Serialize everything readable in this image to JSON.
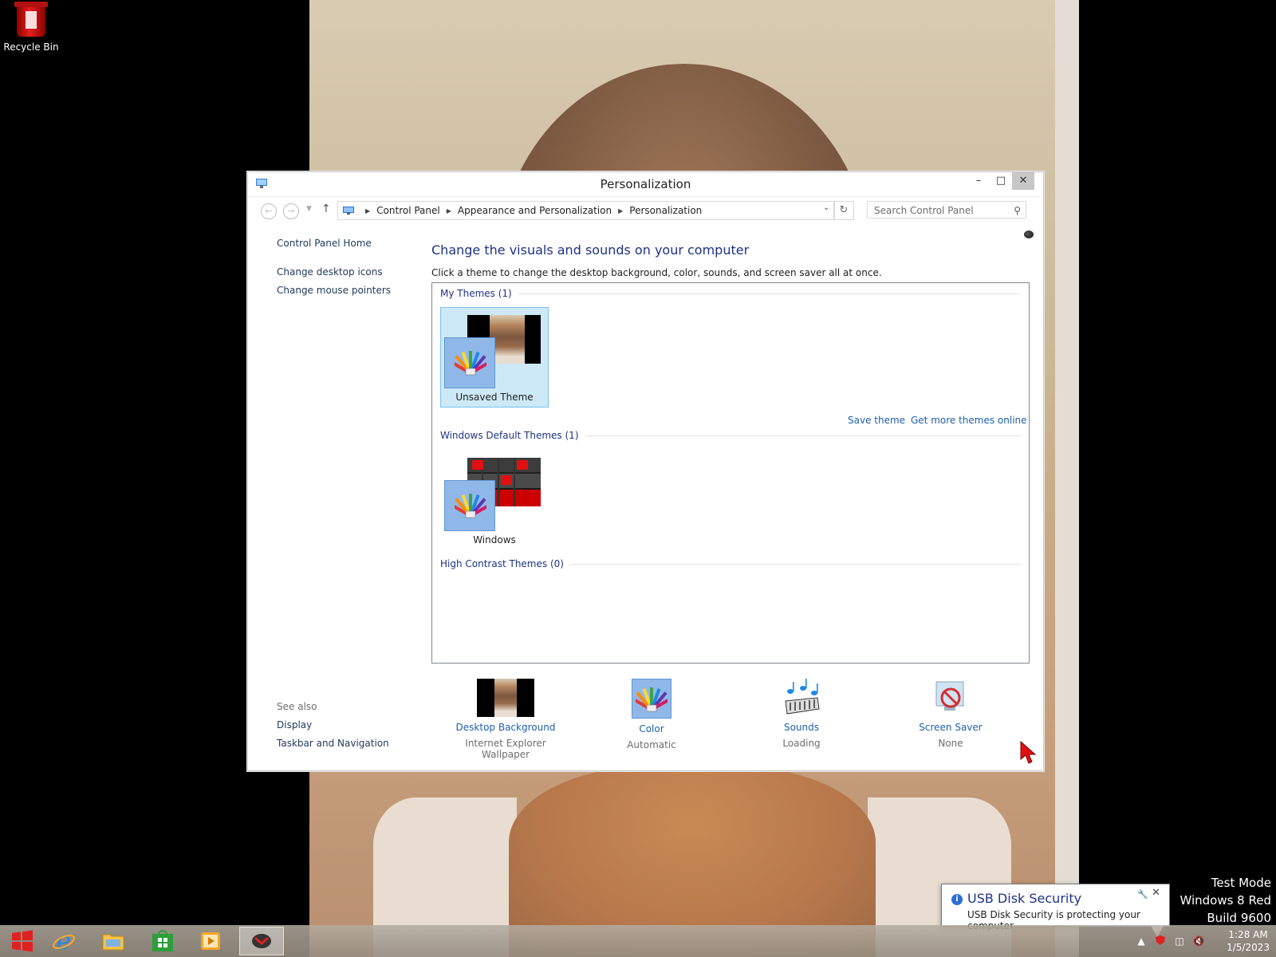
{
  "desktop": {
    "recycle_bin_label": "Recycle Bin"
  },
  "window": {
    "title": "Personalization",
    "breadcrumbs": [
      "Control Panel",
      "Appearance and Personalization",
      "Personalization"
    ],
    "search_placeholder": "Search Control Panel",
    "left_links": {
      "home": "Control Panel Home",
      "desktop_icons": "Change desktop icons",
      "mouse_pointers": "Change mouse pointers"
    },
    "see_also": {
      "heading": "See also",
      "display": "Display",
      "taskbar": "Taskbar and Navigation"
    },
    "heading": "Change the visuals and sounds on your computer",
    "description": "Click a theme to change the desktop background, color, sounds, and screen saver all at once.",
    "groups": {
      "my_themes": "My Themes (1)",
      "default_themes": "Windows Default Themes (1)",
      "high_contrast": "High Contrast Themes (0)"
    },
    "themes": {
      "unsaved": "Unsaved Theme",
      "windows": "Windows"
    },
    "links": {
      "save_theme": "Save theme",
      "more_themes": "Get more themes online"
    },
    "settings": [
      {
        "name": "Desktop Background",
        "value": "Internet Explorer Wallpaper"
      },
      {
        "name": "Color",
        "value": "Automatic"
      },
      {
        "name": "Sounds",
        "value": "Loading"
      },
      {
        "name": "Screen Saver",
        "value": "None"
      }
    ]
  },
  "notification": {
    "title": "USB Disk Security",
    "text": "USB Disk Security is protecting your computer"
  },
  "watermark": {
    "line1": "Test Mode",
    "line2": "Windows 8 Red",
    "line3": "Build 9600"
  },
  "clock": {
    "time": "1:28 AM",
    "date": "1/5/2023"
  },
  "colors": {
    "link_blue": "#1e5fab",
    "heading_blue": "#1e3287",
    "selection_bg": "#cde8f6"
  }
}
